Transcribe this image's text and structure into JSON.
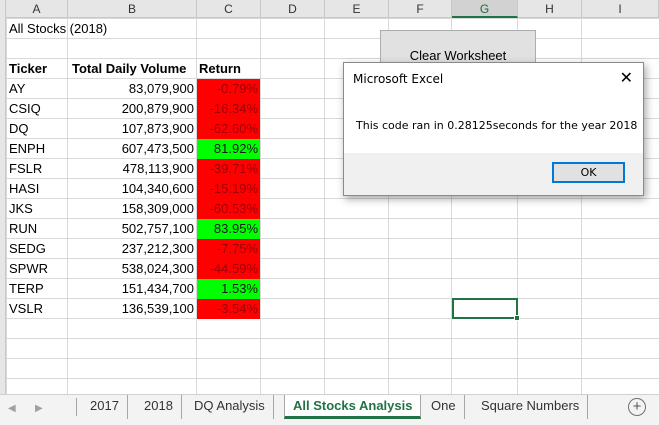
{
  "columns": [
    "A",
    "B",
    "C",
    "D",
    "E",
    "F",
    "G",
    "H",
    "I"
  ],
  "selected_column": "G",
  "sheet": {
    "title": "All Stocks (2018)",
    "headers": {
      "ticker": "Ticker",
      "volume": "Total Daily Volume",
      "return": "Return"
    },
    "rows": [
      {
        "ticker": "AY",
        "volume": "83,079,900",
        "return": "-0.79%",
        "positive": false
      },
      {
        "ticker": "CSIQ",
        "volume": "200,879,900",
        "return": "-16.34%",
        "positive": false
      },
      {
        "ticker": "DQ",
        "volume": "107,873,900",
        "return": "-62.60%",
        "positive": false
      },
      {
        "ticker": "ENPH",
        "volume": "607,473,500",
        "return": "81.92%",
        "positive": true
      },
      {
        "ticker": "FSLR",
        "volume": "478,113,900",
        "return": "-39.71%",
        "positive": false
      },
      {
        "ticker": "HASI",
        "volume": "104,340,600",
        "return": "-15.19%",
        "positive": false
      },
      {
        "ticker": "JKS",
        "volume": "158,309,000",
        "return": "-60.53%",
        "positive": false
      },
      {
        "ticker": "RUN",
        "volume": "502,757,100",
        "return": "83.95%",
        "positive": true
      },
      {
        "ticker": "SEDG",
        "volume": "237,212,300",
        "return": "-7.75%",
        "positive": false
      },
      {
        "ticker": "SPWR",
        "volume": "538,024,300",
        "return": "-44.59%",
        "positive": false
      },
      {
        "ticker": "TERP",
        "volume": "151,434,700",
        "return": "1.53%",
        "positive": true
      },
      {
        "ticker": "VSLR",
        "volume": "136,539,100",
        "return": "-3.54%",
        "positive": false
      }
    ]
  },
  "clear_button": {
    "label": "Clear Worksheet"
  },
  "dialog": {
    "title": "Microsoft Excel",
    "close_glyph": "✕",
    "message": "This code ran in 0.28125seconds for the year 2018",
    "ok_label": "OK"
  },
  "tabs": [
    {
      "label": "2017",
      "active": false
    },
    {
      "label": "2018",
      "active": false
    },
    {
      "label": "DQ Analysis",
      "active": false
    },
    {
      "label": "All Stocks Analysis",
      "active": true
    },
    {
      "label": "One",
      "active": false
    },
    {
      "label": "Square Numbers",
      "active": false
    }
  ],
  "tab_nav": {
    "prev": "◀",
    "next": "▶",
    "add": "+"
  },
  "colors": {
    "negative_fill": "#ff0000",
    "positive_fill": "#00ff00",
    "excel_green": "#217346",
    "dialog_accent": "#0078d7"
  }
}
